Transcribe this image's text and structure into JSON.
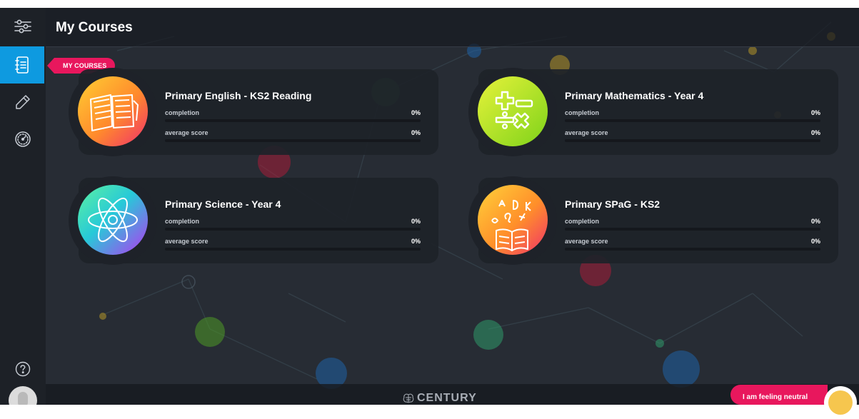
{
  "page": {
    "title": "My Courses"
  },
  "sidebar": {
    "items": [
      {
        "name": "menu-toggle",
        "icon": "sliders-icon"
      },
      {
        "name": "my-courses",
        "icon": "notebook-icon",
        "active": true,
        "tooltip": "MY COURSES"
      },
      {
        "name": "assignments",
        "icon": "pencil-icon"
      },
      {
        "name": "dashboard",
        "icon": "speedometer-icon"
      },
      {
        "name": "help",
        "icon": "question-icon"
      }
    ],
    "accent_color": "#0e9ae0"
  },
  "courses": [
    {
      "title": "Primary English - KS2 Reading",
      "icon": "open-book-icon",
      "completion_label": "completion",
      "completion_value": "0%",
      "completion_fraction": 0,
      "score_label": "average score",
      "score_value": "0%",
      "score_fraction": 0
    },
    {
      "title": "Primary Mathematics - Year 4",
      "icon": "math-symbols-icon",
      "completion_label": "completion",
      "completion_value": "0%",
      "completion_fraction": 0,
      "score_label": "average score",
      "score_value": "0%",
      "score_fraction": 0
    },
    {
      "title": "Primary Science - Year 4",
      "icon": "atom-icon",
      "completion_label": "completion",
      "completion_value": "0%",
      "completion_fraction": 0,
      "score_label": "average score",
      "score_value": "0%",
      "score_fraction": 0
    },
    {
      "title": "Primary SPaG - KS2",
      "icon": "letters-book-icon",
      "completion_label": "completion",
      "completion_value": "0%",
      "completion_fraction": 0,
      "score_label": "average score",
      "score_value": "0%",
      "score_fraction": 0
    }
  ],
  "footer": {
    "brand": "CENTURY"
  },
  "mood": {
    "text": "I am feeling neutral",
    "icon": "neutral-face-icon",
    "color": "#e8175d"
  }
}
